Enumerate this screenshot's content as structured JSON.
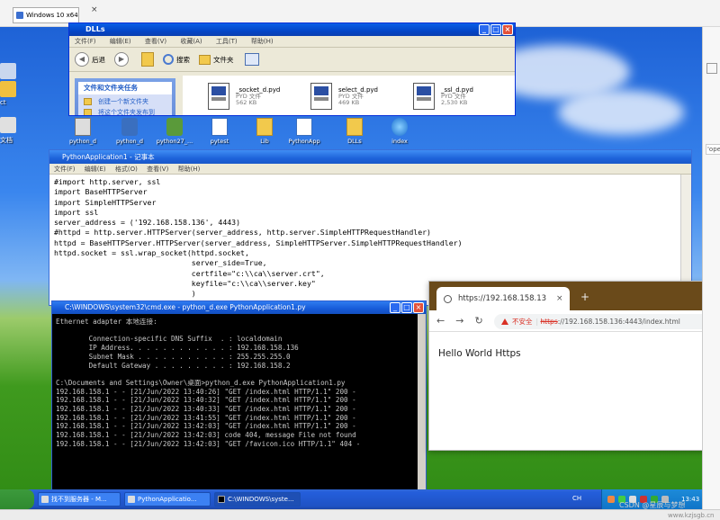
{
  "vm": {
    "tab_title": "Windows 10 x64",
    "close_glyph": "×",
    "side_option": "'ope",
    "watermark": "CSDN @星辰与梦想",
    "watermark_site": "www.kzjsgb.cn"
  },
  "desktop": {
    "left_icons": [
      {
        "label": ""
      },
      {
        "label": "ct"
      },
      {
        "label": "文档"
      }
    ],
    "row_icons": [
      {
        "label": "python_d",
        "icon": "exe-icon"
      },
      {
        "label": "python_d",
        "icon": "python-icon"
      },
      {
        "label": "python27_...",
        "icon": "python-icon"
      },
      {
        "label": "pytest",
        "icon": "file-icon"
      },
      {
        "label": "Lib",
        "icon": "folder-icon"
      },
      {
        "label": "PythonApp",
        "icon": "file-icon"
      },
      {
        "label": "DLLs",
        "icon": "folder-icon"
      },
      {
        "label": "index",
        "icon": "ie-icon"
      }
    ]
  },
  "explorer": {
    "title": "DLLs",
    "menu": [
      "文件(F)",
      "编辑(E)",
      "查看(V)",
      "收藏(A)",
      "工具(T)",
      "帮助(H)"
    ],
    "toolbar": {
      "back": "后退",
      "search": "搜索",
      "folders": "文件夹"
    },
    "side_heading": "文件和文件夹任务",
    "tasks": [
      "创建一个新文件夹",
      "将这个文件夹发布到"
    ],
    "files": [
      {
        "name": "_socket_d.pyd",
        "type": "PYD 文件",
        "size": "562 KB"
      },
      {
        "name": "select_d.pyd",
        "type": "PYD 文件",
        "size": "469 KB"
      },
      {
        "name": "_ssl_d.pyd",
        "type": "PYD 文件",
        "size": "2,530 KB"
      }
    ]
  },
  "notepad": {
    "title": "PythonApplication1 - 记事本",
    "menu": [
      "文件(F)",
      "编辑(E)",
      "格式(O)",
      "查看(V)",
      "帮助(H)"
    ],
    "content": "#import http.server, ssl\nimport BaseHTTPServer\nimport SimpleHTTPServer\nimport ssl\nserver_address = ('192.168.158.136', 4443)\n#httpd = http.server.HTTPServer(server_address, http.server.SimpleHTTPRequestHandler)\nhttpd = BaseHTTPServer.HTTPServer(server_address, SimpleHTTPServer.SimpleHTTPRequestHandler)\nhttpd.socket = ssl.wrap_socket(httpd.socket,\n                               server_side=True,\n                               certfile=\"c:\\\\ca\\\\server.crt\",\n                               keyfile=\"c:\\\\ca\\\\server.key\"\n                               )\nhttpd.serve_forever()"
  },
  "cmd": {
    "title": "C:\\WINDOWS\\system32\\cmd.exe - python_d.exe PythonApplication1.py",
    "content": "Ethernet adapter 本地连接:\n\n        Connection-specific DNS Suffix  . : localdomain\n        IP Address. . . . . . . . . . . . : 192.168.158.136\n        Subnet Mask . . . . . . . . . . . : 255.255.255.0\n        Default Gateway . . . . . . . . . : 192.168.158.2\n\nC:\\Documents and Settings\\Owner\\桌面>python_d.exe PythonApplication1.py\n192.168.158.1 - - [21/Jun/2022 13:40:26] \"GET /index.html HTTP/1.1\" 200 -\n192.168.158.1 - - [21/Jun/2022 13:40:32] \"GET /index.html HTTP/1.1\" 200 -\n192.168.158.1 - - [21/Jun/2022 13:40:33] \"GET /index.html HTTP/1.1\" 200 -\n192.168.158.1 - - [21/Jun/2022 13:41:55] \"GET /index.html HTTP/1.1\" 200 -\n192.168.158.1 - - [21/Jun/2022 13:42:03] \"GET /index.html HTTP/1.1\" 200 -\n192.168.158.1 - - [21/Jun/2022 13:42:03] code 404, message File not found\n192.168.158.1 - - [21/Jun/2022 13:42:03] \"GET /favicon.ico HTTP/1.1\" 404 -"
  },
  "chrome": {
    "tab_title": "https://192.168.158.13",
    "tab_close": "×",
    "new_tab": "+",
    "insecure_label": "不安全",
    "url_scheme": "https",
    "url_rest": "://192.168.158.136:4443/index.html",
    "page_text": "Hello World Https"
  },
  "taskbar": {
    "items": [
      "找不到服务器 - M...",
      "PythonApplicatio...",
      "C:\\WINDOWS\\syste..."
    ],
    "lang": "CH",
    "clock": "13:43"
  }
}
